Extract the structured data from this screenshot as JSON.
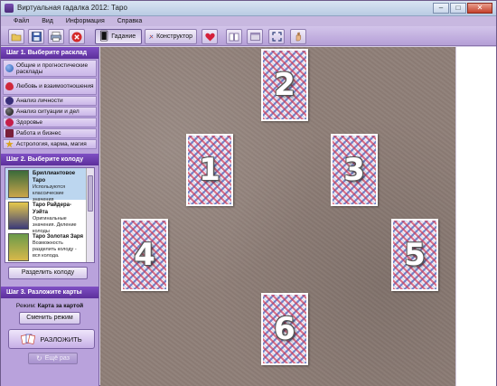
{
  "window": {
    "title": "Виртуальная гадалка 2012: Таро",
    "buttons": {
      "minimize": "–",
      "maximize": "□",
      "close": "✕"
    }
  },
  "menu": [
    "Файл",
    "Вид",
    "Информация",
    "Справка"
  ],
  "toolbar": {
    "icons": [
      "folder-open-icon",
      "save-icon",
      "print-icon",
      "close-circle-icon",
      "heart-icon",
      "book-icon",
      "window-icon",
      "fullscreen-icon",
      "hand-icon"
    ],
    "divination_label": "Гадание",
    "constructor_label": "Конструктор"
  },
  "sidebar": {
    "step1": {
      "title": "Шаг 1. Выберите расклад",
      "items": [
        {
          "label": "Общие и прогностические расклады",
          "icon": "globe-icon",
          "color": "#2f5fb3"
        },
        {
          "label": "Любовь и взаимоотношения",
          "icon": "heart-icon",
          "color": "#d0283c"
        },
        {
          "label": "Анализ личности",
          "icon": "person-icon",
          "color": "#3a2f7a"
        },
        {
          "label": "Анализ ситуации и дел",
          "icon": "dark-sphere-icon",
          "color": "#2a2a3a"
        },
        {
          "label": "Здоровье",
          "icon": "health-icon",
          "color": "#c41e4a"
        },
        {
          "label": "Работа и бизнес",
          "icon": "briefcase-icon",
          "color": "#7a1f3a"
        },
        {
          "label": "Астрология, карма, магия",
          "icon": "star-icon",
          "color": "#d9a21a"
        }
      ]
    },
    "step2": {
      "title": "Шаг 2. Выберите колоду",
      "decks": [
        {
          "name": "Бриллиантовое Таро",
          "desc": "Используются классические значения"
        },
        {
          "name": "Таро Райдера-Уэйта",
          "desc": "Оригинальные значения. Деление колоды"
        },
        {
          "name": "Таро Золотая Заря",
          "desc": "Возможность разделить колоду - вся колода."
        }
      ],
      "split_button": "Разделить колоду"
    },
    "step3": {
      "title": "Шаг 3. Разложите карты",
      "mode_prefix": "Режим:",
      "mode_value": "Карта за картой",
      "change_mode_button": "Сменить режим",
      "lay_out_button": "РАЗЛОЖИТЬ",
      "again_button": "Ещё раз"
    }
  },
  "layout": {
    "cards": [
      "2",
      "1",
      "3",
      "4",
      "5",
      "6"
    ]
  }
}
